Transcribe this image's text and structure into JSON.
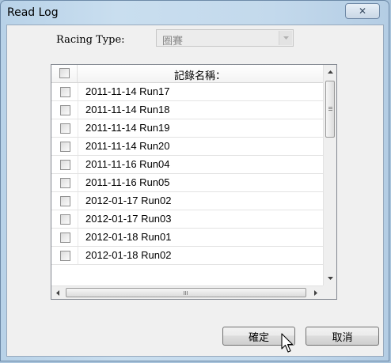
{
  "window": {
    "title": "Read Log",
    "close_glyph": "✕"
  },
  "filter": {
    "label": "Racing Type:",
    "value": "圈賽"
  },
  "list": {
    "header": "記錄名稱：",
    "rows": [
      "2011-11-14 Run17",
      "2011-11-14 Run18",
      "2011-11-14 Run19",
      "2011-11-14 Run20",
      "2011-11-16 Run04",
      "2011-11-16 Run05",
      "2012-01-17 Run02",
      "2012-01-17 Run03",
      "2012-01-18 Run01",
      "2012-01-18 Run02"
    ]
  },
  "buttons": {
    "ok": "確定",
    "cancel": "取消"
  }
}
